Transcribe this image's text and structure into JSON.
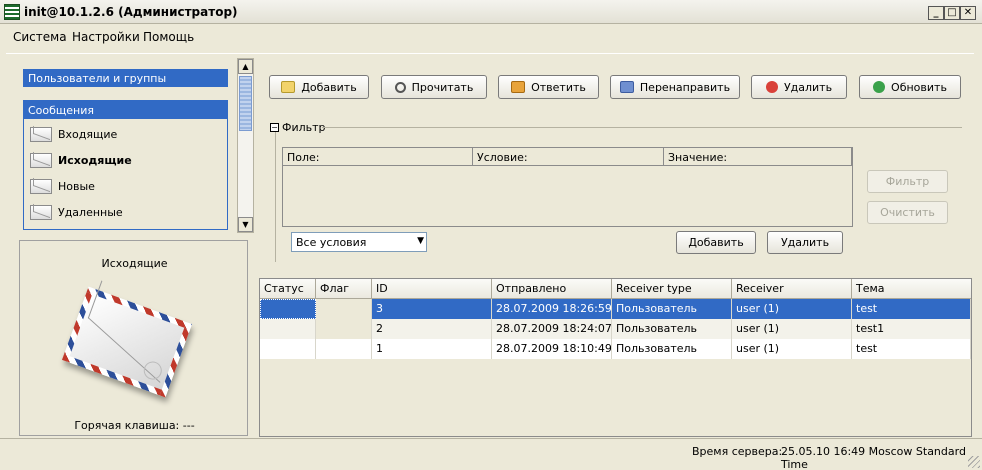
{
  "window": {
    "title": "init@10.1.2.6 (Администратор)"
  },
  "menu": {
    "items": [
      "Система",
      "Настройки",
      "Помощь"
    ]
  },
  "nav": {
    "group_users": "Пользователи и группы",
    "group_messages": "Сообщения",
    "items": [
      {
        "label": "Входящие",
        "bold": false
      },
      {
        "label": "Исходящие",
        "bold": true
      },
      {
        "label": "Новые",
        "bold": false
      },
      {
        "label": "Удаленные",
        "bold": false
      }
    ]
  },
  "preview": {
    "title": "Исходящие",
    "hotkey": "Горячая клавиша: ---"
  },
  "toolbar": {
    "add": "Добавить",
    "read": "Прочитать",
    "reply": "Ответить",
    "forward": "Перенаправить",
    "delete": "Удалить",
    "refresh": "Обновить"
  },
  "filter": {
    "legend": "Фильтр",
    "columns": [
      "Поле:",
      "Условие:",
      "Значение:"
    ],
    "condition_select": "Все условия",
    "add": "Добавить",
    "delete": "Удалить",
    "apply": "Фильтр",
    "clear": "Очистить"
  },
  "messages": {
    "columns": [
      "Статус",
      "Флаг",
      "ID",
      "Отправлено",
      "Receiver type",
      "Receiver",
      "Тема"
    ],
    "rows": [
      {
        "status": "",
        "flag": "",
        "id": "3",
        "sent": "28.07.2009 18:26:59",
        "receiver_type": "Пользователь",
        "receiver": "user (1)",
        "subject": "test",
        "selected": true
      },
      {
        "status": "",
        "flag": "",
        "id": "2",
        "sent": "28.07.2009 18:24:07",
        "receiver_type": "Пользователь",
        "receiver": "user (1)",
        "subject": "test1",
        "selected": false
      },
      {
        "status": "",
        "flag": "",
        "id": "1",
        "sent": "28.07.2009 18:10:49",
        "receiver_type": "Пользователь",
        "receiver": "user (1)",
        "subject": "test",
        "selected": false
      }
    ]
  },
  "status": {
    "label": "Время сервера:",
    "value": "25.05.10 16:49 Moscow Standard Time"
  },
  "colors": {
    "selection": "#316ac5",
    "background": "#ece9d8"
  }
}
